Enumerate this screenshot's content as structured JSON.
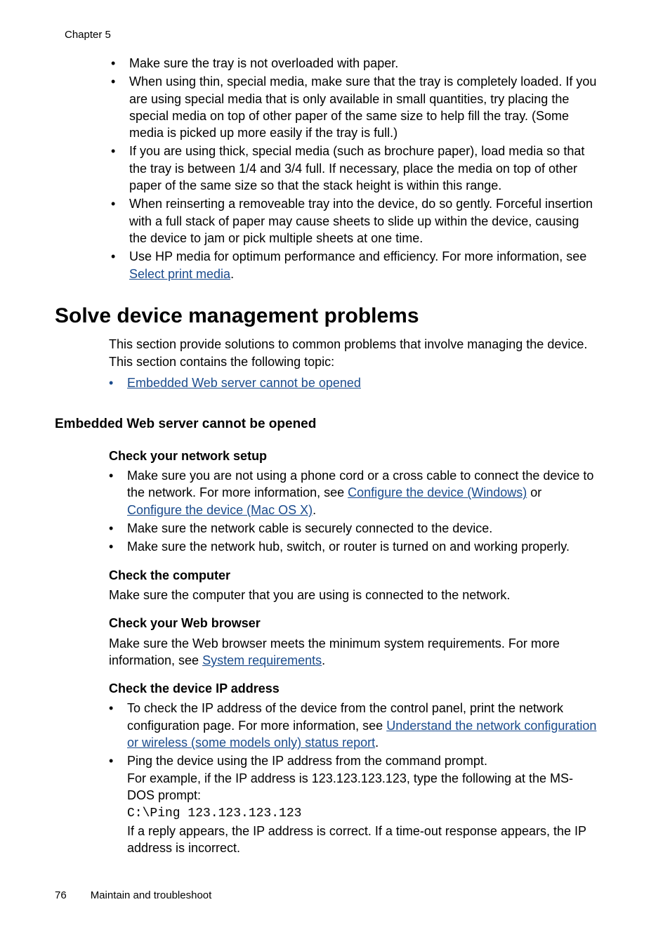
{
  "header": {
    "chapter": "Chapter 5"
  },
  "bullets_top": [
    "Make sure the tray is not overloaded with paper.",
    "When using thin, special media, make sure that the tray is completely loaded. If you are using special media that is only available in small quantities, try placing the special media on top of other paper of the same size to help fill the tray. (Some media is picked up more easily if the tray is full.)",
    "If you are using thick, special media (such as brochure paper), load media so that the tray is between 1/4 and 3/4 full. If necessary, place the media on top of other paper of the same size so that the stack height is within this range.",
    "When reinserting a removeable tray into the device, do so gently. Forceful insertion with a full stack of paper may cause sheets to slide up within the device, causing the device to jam or pick multiple sheets at one time."
  ],
  "bullet_hp": {
    "pre": "Use HP media for optimum performance and efficiency. For more information, see ",
    "link": "Select print media",
    "post": "."
  },
  "h1": "Solve device management problems",
  "intro": "This section provide solutions to common problems that involve managing the device. This section contains the following topic:",
  "toc_link": "Embedded Web server cannot be opened",
  "h2": "Embedded Web server cannot be opened",
  "network_setup": {
    "heading": "Check your network setup",
    "b1": {
      "pre": "Make sure you are not using a phone cord or a cross cable to connect the device to the network. For more information, see ",
      "link1": "Configure the device (Windows)",
      "mid": " or ",
      "link2": "Configure the device (Mac OS X)",
      "post": "."
    },
    "b2": "Make sure the network cable is securely connected to the device.",
    "b3": "Make sure the network hub, switch, or router is turned on and working properly."
  },
  "check_computer": {
    "heading": "Check the computer",
    "text": "Make sure the computer that you are using is connected to the network."
  },
  "check_browser": {
    "heading": "Check your Web browser",
    "pre": "Make sure the Web browser meets the minimum system requirements. For more information, see ",
    "link": "System requirements",
    "post": "."
  },
  "check_ip": {
    "heading": "Check the device IP address",
    "b1": {
      "pre": "To check the IP address of the device from the control panel, print the network configuration page. For more information, see ",
      "link": "Understand the network configuration or wireless (some models only) status report",
      "post": "."
    },
    "b2_line1": "Ping the device using the IP address from the command prompt.",
    "b2_line2": "For example, if the IP address is 123.123.123.123, type the following at the MS-DOS prompt:",
    "b2_code": "C:\\Ping 123.123.123.123",
    "b2_line3": "If a reply appears, the IP address is correct. If a time-out response appears, the IP address is incorrect."
  },
  "footer": {
    "page": "76",
    "title": "Maintain and troubleshoot"
  }
}
